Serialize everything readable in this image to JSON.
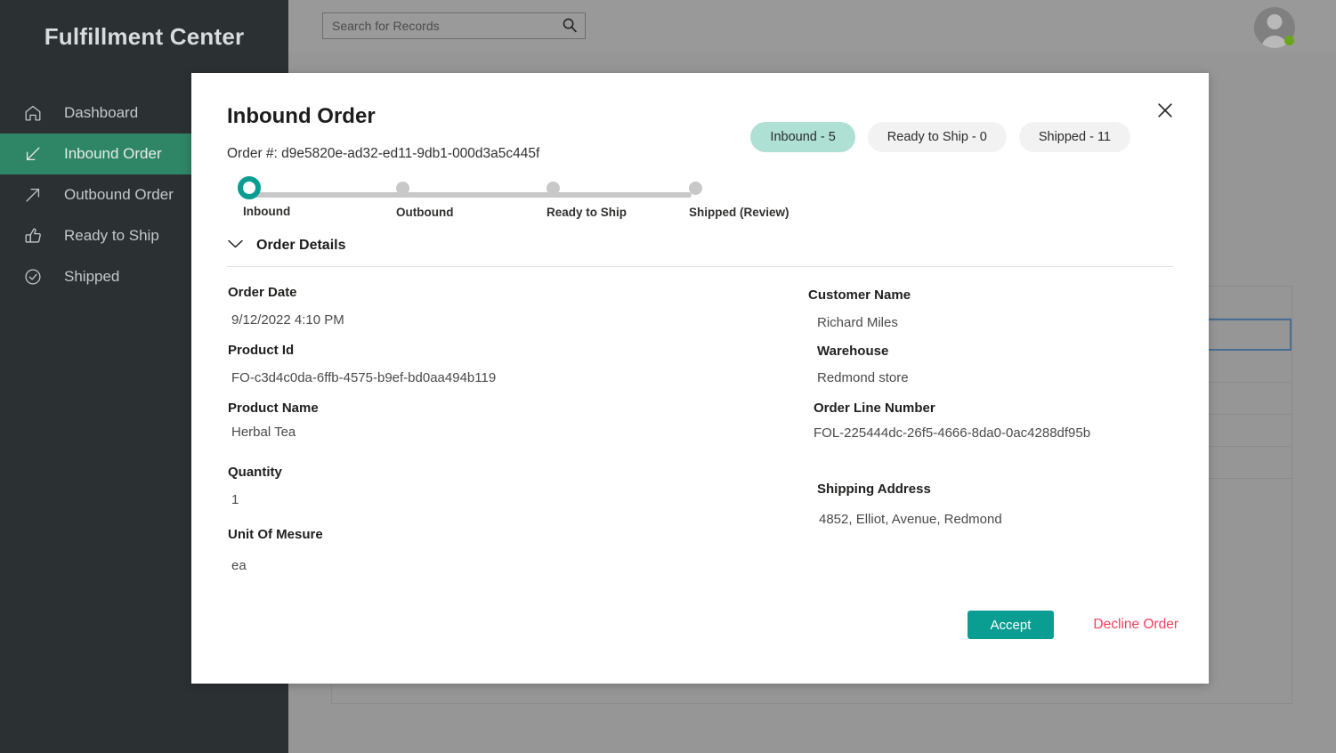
{
  "app": {
    "brand": "Fulfillment Center"
  },
  "search": {
    "placeholder": "Search for Records",
    "value": "",
    "icon": "search-icon"
  },
  "user": {
    "avatar_icon": "avatar-person-icon",
    "presence": "available",
    "presence_color": "#6aa61b"
  },
  "sidebar": {
    "items": [
      {
        "label": "Dashboard",
        "icon": "home-icon",
        "active": false
      },
      {
        "label": "Inbound Order",
        "icon": "arrow-down-left-icon",
        "active": true
      },
      {
        "label": "Outbound Order",
        "icon": "arrow-up-right-icon",
        "active": false
      },
      {
        "label": "Ready to Ship",
        "icon": "thumbs-up-icon",
        "active": false
      },
      {
        "label": "Shipped",
        "icon": "check-circle-icon",
        "active": false
      }
    ],
    "active_color": "#2f8667",
    "background_color": "#2b3033"
  },
  "modal": {
    "title": "Inbound Order",
    "order_number_label": "Order #: d9e5820e-ad32-ed11-9db1-000d3a5c445f",
    "close_icon": "close-icon",
    "pills": [
      {
        "label": "Inbound - 5",
        "active": true
      },
      {
        "label": "Ready to Ship - 0",
        "active": false
      },
      {
        "label": "Shipped - 11",
        "active": false
      }
    ],
    "pill_active_color": "#aee0d4",
    "stepper": {
      "steps": [
        {
          "label": "Inbound",
          "state": "current"
        },
        {
          "label": "Outbound",
          "state": "pending"
        },
        {
          "label": "Ready to Ship",
          "state": "pending"
        },
        {
          "label": "Shipped (Review)",
          "state": "pending"
        }
      ],
      "current_color": "#0a9d92",
      "pending_color": "#c8c8c8"
    },
    "section": {
      "title": "Order Details",
      "chevron_icon": "chevron-down-icon",
      "expanded": true
    },
    "fields_left": [
      {
        "label": "Order Date",
        "value": "9/12/2022 4:10 PM"
      },
      {
        "label": "Product Id",
        "value": "FO-c3d4c0da-6ffb-4575-b9ef-bd0aa494b119"
      },
      {
        "label": "Product Name",
        "value": "Herbal Tea"
      },
      {
        "label": "Quantity",
        "value": "1"
      },
      {
        "label": "Unit Of Mesure",
        "value": "ea"
      }
    ],
    "fields_right": [
      {
        "label": "Customer Name",
        "value": "Richard Miles"
      },
      {
        "label": "Warehouse",
        "value": "Redmond store"
      },
      {
        "label": "Order Line Number",
        "value": "FOL-225444dc-26f5-4666-8da0-0ac4288df95b"
      },
      {
        "label": "Shipping Address",
        "value": "4852, Elliot, Avenue, Redmond"
      }
    ],
    "accept_label": "Accept",
    "accept_color": "#0a9d92",
    "decline_label": "Decline Order",
    "decline_color": "#f5405e"
  },
  "background_list": {
    "row_count": 6,
    "selected_row_index": 1,
    "selected_border_color": "#4a6d96"
  }
}
